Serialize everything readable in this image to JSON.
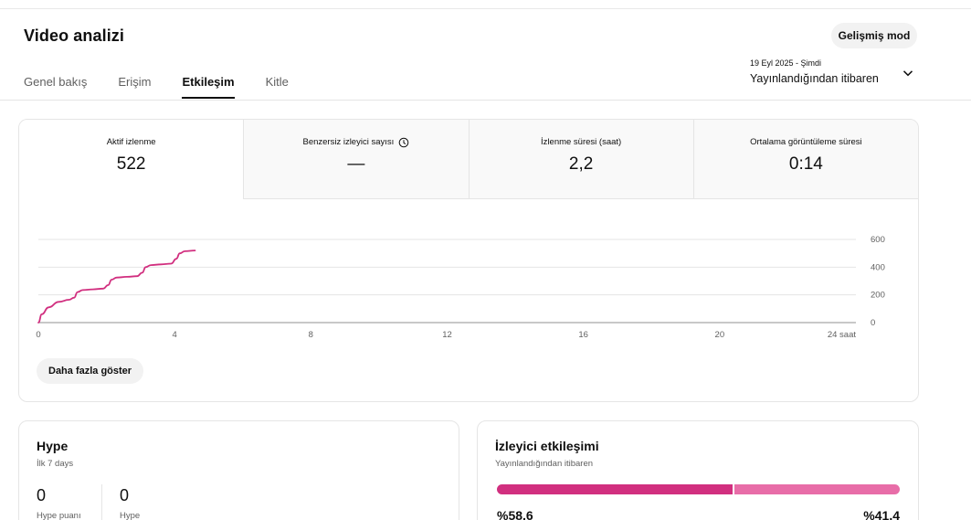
{
  "header": {
    "title": "Video analizi",
    "advanced_mode_label": "Gelişmiş mod"
  },
  "tabs": [
    {
      "label": "Genel bakış",
      "active": false
    },
    {
      "label": "Erişim",
      "active": false
    },
    {
      "label": "Etkileşim",
      "active": true
    },
    {
      "label": "Kitle",
      "active": false
    }
  ],
  "date_range": {
    "range": "19 Eyl 2025 - Şimdi",
    "label": "Yayınlandığından itibaren"
  },
  "metrics": [
    {
      "label": "Aktif izlenme",
      "value": "522",
      "active": true
    },
    {
      "label": "Benzersiz izleyici sayısı",
      "value": "—",
      "active": false,
      "icon": "clock-icon"
    },
    {
      "label": "İzlenme süresi (saat)",
      "value": "2,2",
      "active": false
    },
    {
      "label": "Ortalama görüntüleme süresi",
      "value": "0:14",
      "active": false
    }
  ],
  "chart_data": {
    "type": "line",
    "x_ticks": [
      "0",
      "4",
      "8",
      "12",
      "16",
      "20",
      "24 saat"
    ],
    "y_ticks": [
      "0",
      "200",
      "400",
      "600"
    ],
    "xlim": [
      0,
      24
    ],
    "ylim": [
      0,
      600
    ],
    "grid": true,
    "color": "#d12f7f",
    "series": [
      {
        "x": [
          0,
          0.1,
          0.3,
          0.6,
          0.9,
          1.05,
          1.15,
          1.3,
          1.6,
          1.9,
          2.05,
          2.15,
          2.3,
          2.6,
          2.9,
          3.05,
          3.15,
          3.3,
          3.6,
          3.9,
          4.05,
          4.15,
          4.3,
          4.6
        ],
        "y": [
          0,
          60,
          110,
          150,
          165,
          180,
          220,
          235,
          240,
          245,
          270,
          310,
          325,
          330,
          335,
          360,
          400,
          415,
          420,
          425,
          460,
          500,
          515,
          520
        ]
      }
    ]
  },
  "show_more_label": "Daha fazla göster",
  "hype": {
    "title": "Hype",
    "subtitle": "İlk 7 days",
    "stats": [
      {
        "value": "0",
        "label": "Hype puanı"
      },
      {
        "value": "0",
        "label": "Hype"
      }
    ]
  },
  "engagement": {
    "title": "İzleyici etkileşimi",
    "subtitle": "Yayınlandığından itibaren",
    "percent_a": 58.6,
    "percent_b": 41.4,
    "label_a": "%58,6",
    "label_b": "%41,4",
    "color_a": "#d12f7f",
    "color_b": "#e86da8"
  }
}
